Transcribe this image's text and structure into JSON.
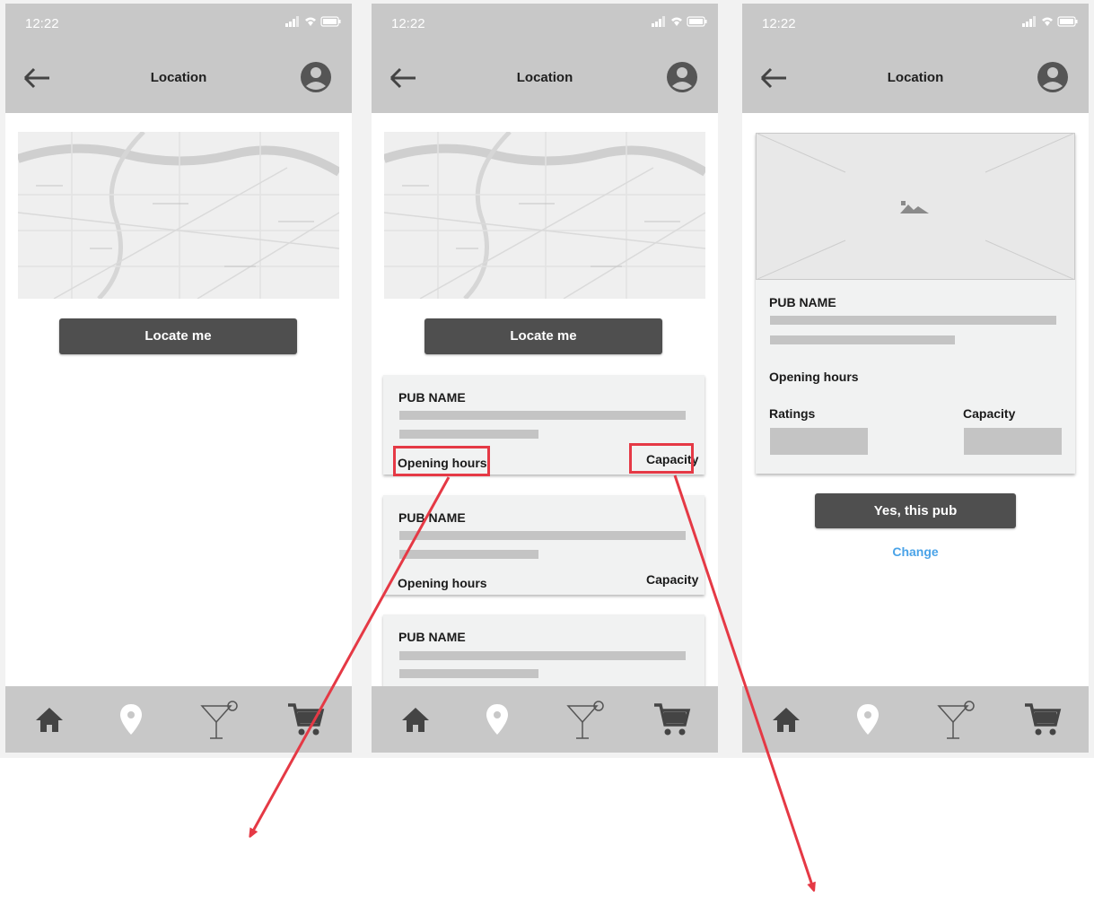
{
  "status_bar": {
    "time": "12:22"
  },
  "nav": {
    "title": "Location"
  },
  "map": {
    "description_icon": "map-image"
  },
  "actions": {
    "locate_label": "Locate me",
    "confirm_label": "Yes, this pub",
    "change_label": "Change"
  },
  "pub_cards": [
    {
      "name": "PUB NAME",
      "opening_hours": "Opening hours",
      "capacity": "Capacity"
    },
    {
      "name": "PUB NAME",
      "opening_hours": "Opening hours",
      "capacity": "Capacity"
    },
    {
      "name": "PUB NAME"
    }
  ],
  "detail": {
    "name": "PUB NAME",
    "opening_hours": "Opening hours",
    "ratings": "Ratings",
    "capacity": "Capacity"
  },
  "tabs": [
    "home-icon",
    "location-pin-icon",
    "cocktail-icon",
    "cart-icon"
  ],
  "annotation_color": "#e53945"
}
